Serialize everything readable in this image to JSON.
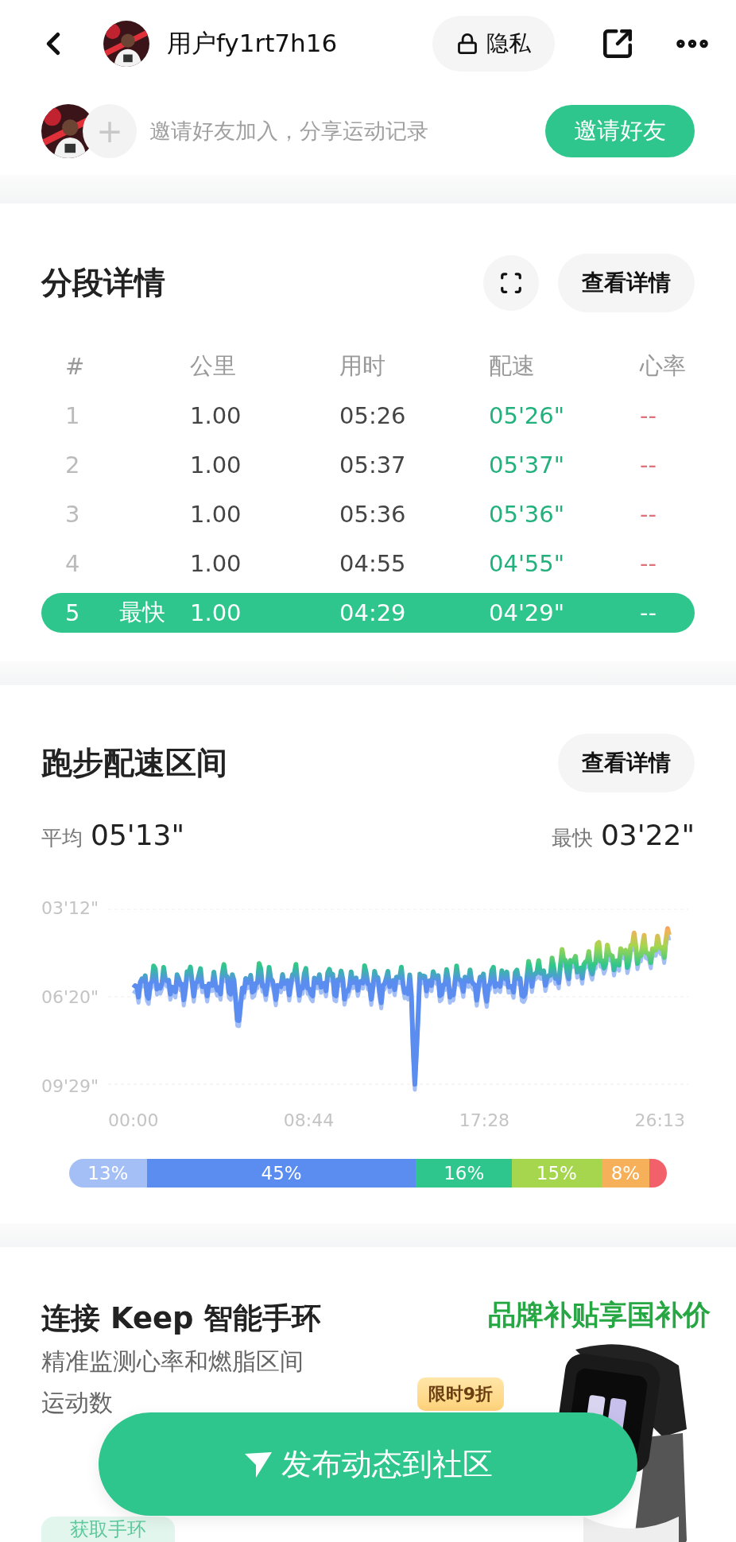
{
  "top_bar": {
    "username": "用户fy1rt7h16",
    "privacy_label": "隐私"
  },
  "invite": {
    "text": "邀请好友加入，分享运动记录",
    "plus": "+",
    "button": "邀请好友"
  },
  "splits": {
    "title": "分段详情",
    "detail_button": "查看详情",
    "columns": [
      "#",
      "公里",
      "用时",
      "配速",
      "心率"
    ],
    "rows": [
      {
        "index": "1",
        "km": "1.00",
        "time": "05:26",
        "pace": "05'26\"",
        "heart_rate": "--",
        "selected": false
      },
      {
        "index": "2",
        "km": "1.00",
        "time": "05:37",
        "pace": "05'37\"",
        "heart_rate": "--",
        "selected": false
      },
      {
        "index": "3",
        "km": "1.00",
        "time": "05:36",
        "pace": "05'36\"",
        "heart_rate": "--",
        "selected": false
      },
      {
        "index": "4",
        "km": "1.00",
        "time": "04:55",
        "pace": "04'55\"",
        "heart_rate": "--",
        "selected": false
      },
      {
        "index": "5",
        "badge": "最快",
        "km": "1.00",
        "time": "04:29",
        "pace": "04'29\"",
        "heart_rate": "--",
        "selected": true
      }
    ]
  },
  "pace_zones": {
    "title": "跑步配速区间",
    "detail_button": "查看详情",
    "average_label": "平均",
    "average_value": "05'13\"",
    "fastest_label": "最快",
    "fastest_value": "03'22\"",
    "y_axis_labels": [
      "03'12\"",
      "06'20\"",
      "09'29\""
    ],
    "x_axis_labels": [
      "00:00",
      "08:44",
      "17:28",
      "26:13"
    ],
    "distribution": [
      {
        "label": "13%",
        "color": "#a4bff5"
      },
      {
        "label": "45%",
        "color": "#5b8cf0"
      },
      {
        "label": "16%",
        "color": "#2ec68c"
      },
      {
        "label": "15%",
        "color": "#a6d64e"
      },
      {
        "label": "8%",
        "color": "#f7b05a"
      },
      {
        "color": "#f2606a"
      }
    ]
  },
  "band_promo": {
    "title": "连接 Keep 智能手环",
    "lines": [
      "精准监测心率和燃脂区间",
      "运动数"
    ],
    "ad_title": "品牌补贴享国补价",
    "ad_badge": "限时9折",
    "button": "获取手环"
  },
  "publish_button": "发布动态到社区"
}
